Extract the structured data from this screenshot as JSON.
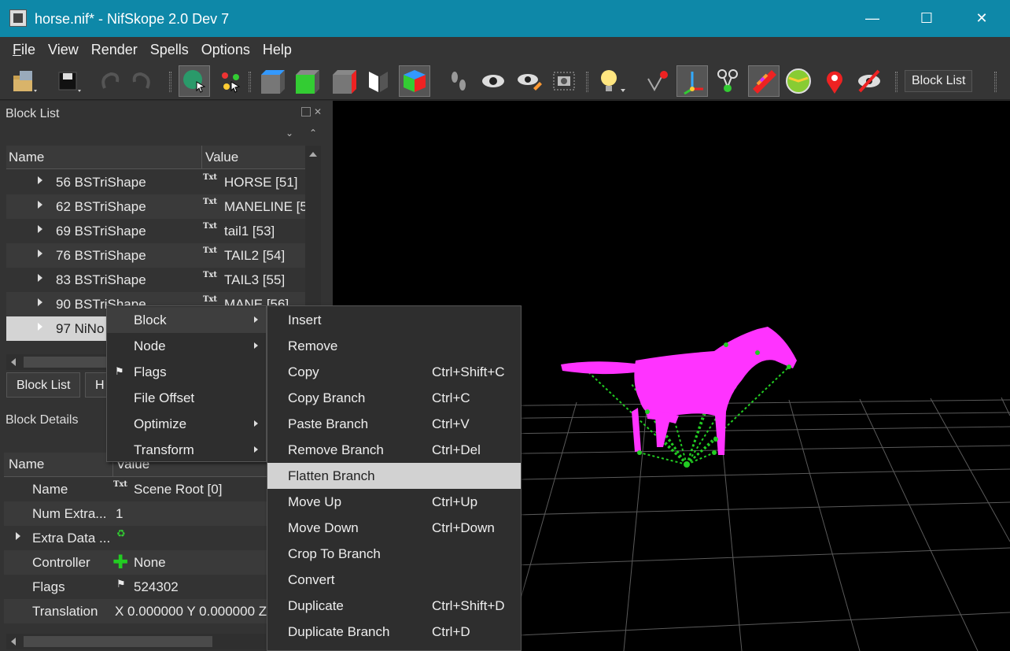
{
  "window": {
    "title": "horse.nif* - NifSkope 2.0 Dev 7",
    "minimize_glyph": "—",
    "maximize_glyph": "☐",
    "close_glyph": "✕"
  },
  "menubar": {
    "items": [
      {
        "label": "File",
        "underline": "F",
        "rest": "ile"
      },
      {
        "label": "View"
      },
      {
        "label": "Render"
      },
      {
        "label": "Spells"
      },
      {
        "label": "Options"
      },
      {
        "label": "Help"
      }
    ]
  },
  "toolbar": {
    "block_list_label": "Block List",
    "icons": [
      "open-icon",
      "save-icon",
      "undo-icon",
      "redo-icon",
      "select-object-icon",
      "select-vertex-icon",
      "view-top-icon",
      "view-front-icon",
      "view-side-icon",
      "view-flip-icon",
      "view-iso-icon",
      "walk-icon",
      "eye-icon",
      "eye-edit-icon",
      "screenshot-icon",
      "light-icon",
      "show-axes-icon",
      "axis-gizmo-icon",
      "nodes-icon",
      "textures-icon",
      "dome-icon",
      "marker-icon",
      "hide-icon"
    ]
  },
  "block_list": {
    "title": "Block List",
    "header": {
      "name": "Name",
      "value": "Value"
    },
    "rows": [
      {
        "name": "56 BSTriShape",
        "txt": "Txt",
        "value": "HORSE [51]"
      },
      {
        "name": "62 BSTriShape",
        "txt": "Txt",
        "value": "MANELINE [5"
      },
      {
        "name": "69 BSTriShape",
        "txt": "Txt",
        "value": "tail1 [53]"
      },
      {
        "name": "76 BSTriShape",
        "txt": "Txt",
        "value": "TAIL2 [54]"
      },
      {
        "name": "83 BSTriShape",
        "txt": "Txt",
        "value": "TAIL3 [55]"
      },
      {
        "name": "90 BSTriShape",
        "txt": "Txt",
        "value": "MANE [56]"
      },
      {
        "name": "97 NiNo",
        "txt": "",
        "value": ""
      }
    ],
    "tabs": [
      "Block List",
      "H"
    ]
  },
  "block_details": {
    "title": "Block Details",
    "header": {
      "name": "Name",
      "value": "Value"
    },
    "rows": [
      {
        "name": "Name",
        "icon": "Txt",
        "value": "Scene Root [0]"
      },
      {
        "name": "Num Extra...",
        "icon": "",
        "value": "1"
      },
      {
        "name": "Extra Data ...",
        "icon": "♻",
        "value": ""
      },
      {
        "name": "Controller",
        "icon": "✚",
        "value": "None"
      },
      {
        "name": "Flags",
        "icon": "⚑",
        "value": "524302"
      },
      {
        "name": "Translation",
        "icon": "",
        "value": "X 0.000000 Y 0.000000 Z"
      }
    ]
  },
  "context_menu": {
    "items": [
      {
        "label": "Block",
        "submenu": true
      },
      {
        "label": "Node",
        "submenu": true
      },
      {
        "label": "Flags",
        "icon": "⚑",
        "submenu": false
      },
      {
        "label": "File Offset",
        "submenu": false
      },
      {
        "label": "Optimize",
        "submenu": true
      },
      {
        "label": "Transform",
        "submenu": true
      }
    ]
  },
  "block_submenu": {
    "items": [
      {
        "label": "Insert",
        "shortcut": ""
      },
      {
        "label": "Remove",
        "shortcut": ""
      },
      {
        "label": "Copy",
        "shortcut": "Ctrl+Shift+C"
      },
      {
        "label": "Copy Branch",
        "shortcut": "Ctrl+C"
      },
      {
        "label": "Paste Branch",
        "shortcut": "Ctrl+V"
      },
      {
        "label": "Remove Branch",
        "shortcut": "Ctrl+Del"
      },
      {
        "label": "Flatten Branch",
        "shortcut": ""
      },
      {
        "label": "Move Up",
        "shortcut": "Ctrl+Up"
      },
      {
        "label": "Move Down",
        "shortcut": "Ctrl+Down"
      },
      {
        "label": "Crop To Branch",
        "shortcut": ""
      },
      {
        "label": "Convert",
        "shortcut": ""
      },
      {
        "label": "Duplicate",
        "shortcut": "Ctrl+Shift+D"
      },
      {
        "label": "Duplicate Branch",
        "shortcut": "Ctrl+D"
      }
    ]
  },
  "colors": {
    "titlebar": "#0e88a8",
    "horse": "#ff33ff",
    "skeleton": "#22cc22",
    "grid": "#6a6a6a"
  }
}
